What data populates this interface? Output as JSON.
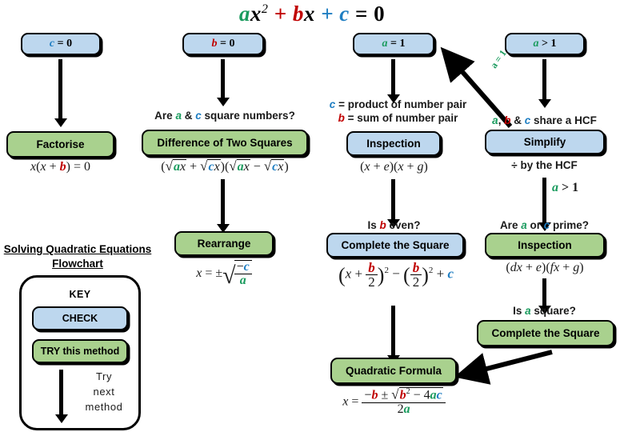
{
  "title_equation": {
    "a": "a",
    "x2": "x",
    "sup": "2",
    "plus1": "+",
    "b": "b",
    "x1": "x",
    "plus2": "+",
    "c": "c",
    "equals": "= 0"
  },
  "chart_label": {
    "line1": "Solving Quadratic Equations",
    "line2": "Flowchart"
  },
  "key": {
    "heading": "KEY",
    "check_label": "CHECK",
    "try_label": "TRY this method",
    "next_line1": "Try",
    "next_line2": "next",
    "next_line3": "method"
  },
  "colors": {
    "a": "#1a9b5e",
    "b": "#c00000",
    "c": "#1f7ec2",
    "check_box": "#bdd7ee",
    "try_box": "#a9d18e",
    "outline": "#000000",
    "background": "#ffffff"
  },
  "columns": [
    {
      "id": "col-c-zero",
      "condition": {
        "var": "c",
        "rest": "= 0"
      },
      "steps": [
        {
          "kind": "try",
          "label": "Factorise",
          "formula": "x(x + b) = 0"
        }
      ]
    },
    {
      "id": "col-b-zero",
      "condition": {
        "var": "b",
        "rest": "= 0"
      },
      "steps": [
        {
          "kind": "try",
          "question": "Are a & c square numbers?",
          "label": "Difference of Two Squares",
          "formula": "(√ax + √cx)(√ax − √cx)"
        },
        {
          "kind": "try",
          "label": "Rearrange",
          "formula": "x = ±√(−c / a)"
        }
      ]
    },
    {
      "id": "col-a-one",
      "condition": {
        "var": "a",
        "rest": "= 1"
      },
      "steps": [
        {
          "kind": "check",
          "question_line1": "c = product of number pair",
          "question_line2": "b = sum of number pair",
          "label": "Inspection",
          "formula": "(x + e)(x + g)"
        },
        {
          "kind": "check",
          "question": "Is b even?",
          "label": "Complete the Square",
          "formula": "(x + b/2)² − (b/2)² + c"
        }
      ]
    },
    {
      "id": "col-a-gt-one",
      "condition": {
        "var": "a",
        "rest": "> 1"
      },
      "steps": [
        {
          "kind": "check",
          "question": "a, b & c share a HCF",
          "label": "Simplify",
          "formula": "÷ by the HCF",
          "edge_label": "a > 1"
        },
        {
          "kind": "try",
          "question": "Are a or c prime?",
          "label": "Inspection",
          "formula": "(dx + e)(fx + g)"
        },
        {
          "kind": "try",
          "question": "Is a square?",
          "label": "Complete the Square"
        }
      ]
    }
  ],
  "final": {
    "label": "Quadratic Formula",
    "formula": "x = (−b ± √(b² − 4ac)) / 2a"
  },
  "edge_labels": {
    "diagonal_a_eq_1": "a = 1"
  },
  "text_literals": {
    "are": "Are",
    "amp": "&",
    "square_numbers": "square numbers?",
    "product_of": "= product of number pair",
    "sum_of": "= sum of number pair",
    "share_hcf": "share a HCF",
    "div_by_hcf": "÷ by the HCF",
    "is_b_even": "Is",
    "even_q": "even?",
    "or": "or",
    "prime_q": "prime?",
    "is_a_square": "Is",
    "square_q": "square?",
    "comma": ",",
    "gt1": "> 1"
  }
}
